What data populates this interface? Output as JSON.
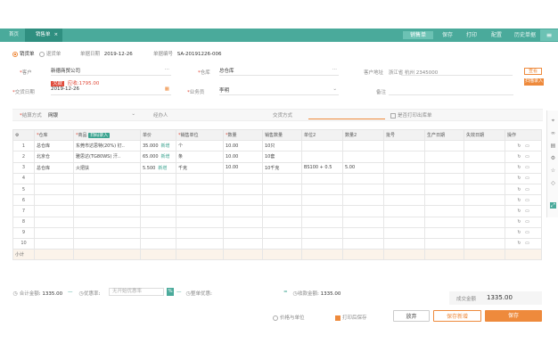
{
  "nav": {
    "home_tab": "首页",
    "active_tab": "销售单",
    "close_glyph": "×",
    "toolbar": [
      {
        "key": "sale",
        "label": "销售单"
      },
      {
        "key": "save",
        "label": "保存"
      },
      {
        "key": "print",
        "label": "打印"
      },
      {
        "key": "config",
        "label": "配置"
      },
      {
        "key": "more",
        "label": "更多"
      }
    ],
    "toolbar_extra": "历史单据"
  },
  "header": {
    "radio_sale": "销货单",
    "radio_return": "退货单",
    "date_label": "单据日期",
    "date_value": "2019-12-26",
    "number_label": "单据编号",
    "number_value": "SA-20191226-006",
    "customer_label": "客户",
    "customer_value": "新德商贸公司",
    "customer_tag": "欠款",
    "customer_debt": "应收:1795.00",
    "warehouse_label": "仓库",
    "warehouse_value": "总仓库",
    "contact_label": "客户地址",
    "contact_value": "浙江省 杭州 2345000",
    "delivery_label": "交货日期",
    "delivery_value": "2019-12-26",
    "salesman_label": "业务员",
    "salesman_value": "李明",
    "remark_label": "备注",
    "settle_label": "结算方式",
    "settle_value": "网银",
    "handler_label": "经办人",
    "project_label": "交货方式",
    "print_check": "是否打印出库单",
    "side_btn1": "查看",
    "side_btn2": "扫描录入"
  },
  "table": {
    "columns": [
      "",
      "仓库",
      "商品",
      "单价",
      "销售单位",
      "数量",
      "销售数量",
      "单位2",
      "数量2",
      "批号",
      "生产日期",
      "失效日期",
      "操作"
    ],
    "stock_btn": "扫码录入",
    "badge": "新增",
    "rows": [
      {
        "idx": "1",
        "wh": "总仓库",
        "item": "东莞市达思特(20%) 钉..",
        "price": "35.000",
        "tag": "新增",
        "unit": "个",
        "qty": "10.00",
        "sqty": "10只",
        "unit2": "",
        "qty2": "",
        "batch": "",
        "mfg": "",
        "exp": ""
      },
      {
        "idx": "2",
        "wh": "北京仓",
        "item": "雅思达(TG80WS) 汗..",
        "price": "65.000",
        "tag": "新增",
        "unit": "条",
        "qty": "10.00",
        "sqty": "10套",
        "unit2": "",
        "qty2": "",
        "batch": "",
        "mfg": "",
        "exp": ""
      },
      {
        "idx": "3",
        "wh": "总仓库",
        "item": "火把扶",
        "price": "5.500",
        "tag": "新增",
        "unit": "千克",
        "qty": "10.00",
        "sqty": "10千克",
        "unit2": "BS100 + 0.5",
        "qty2": "5.00",
        "batch": "",
        "mfg": "",
        "exp": ""
      },
      {
        "idx": "4"
      },
      {
        "idx": "5"
      },
      {
        "idx": "6"
      },
      {
        "idx": "7"
      },
      {
        "idx": "8"
      },
      {
        "idx": "9"
      },
      {
        "idx": "10"
      }
    ],
    "subtotal_label": "小计",
    "op_edit": "↻",
    "op_del": "▭"
  },
  "footer": {
    "total_label": "合计金额",
    "total_value": "1335.00",
    "discount_label": "优惠率",
    "discount_placeholder": "无开始优惠率",
    "discount_amount_label": "整单优惠",
    "received_label": "收款金额",
    "received_value": "1335.00",
    "final_label": "成交金额",
    "final_value": "1335.00",
    "check_label": "价格与单位",
    "check2_label": "打印后保存",
    "btn_cancel": "放弃",
    "btn_save_new": "保存新增",
    "btn_save": "保存"
  },
  "colors": {
    "brand": "#4aaa9b",
    "accent": "#ee8a3c",
    "danger": "#e04a3a"
  }
}
